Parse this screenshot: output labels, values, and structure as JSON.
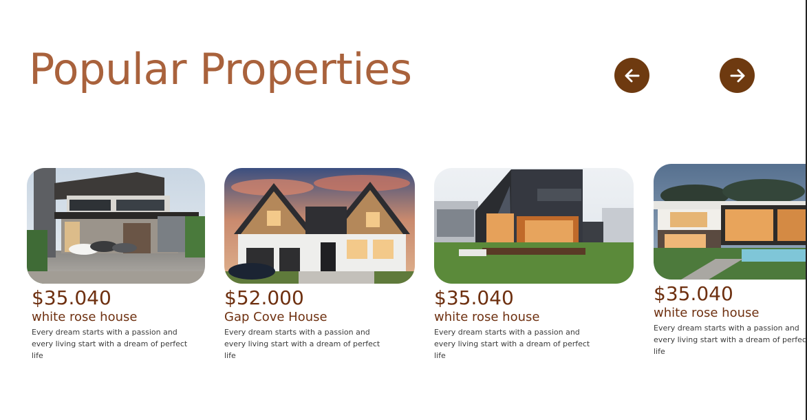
{
  "section": {
    "title": "Popular Properties"
  },
  "carousel": {
    "prev_icon": "arrow-left-icon",
    "next_icon": "arrow-right-icon",
    "button_color": "#6e3a10"
  },
  "colors": {
    "title": "#a9623c",
    "price": "#6e3010",
    "body_text": "#3a3a3a"
  },
  "properties": [
    {
      "price": "$35.040",
      "name": "white rose house",
      "description": "Every dream starts with a passion and every living start with a dream of perfect life",
      "image": "modern-two-story-villa-photo"
    },
    {
      "price": "$52.000",
      "name": "Gap Cove House",
      "description": "Every dream starts with a passion and every living start with a dream of perfect life",
      "image": "gabled-family-house-sunset-photo"
    },
    {
      "price": "$35.040",
      "name": "white rose house",
      "description": "Every dream starts with a passion and every living start with a dream of perfect life",
      "image": "dark-a-frame-house-photo"
    },
    {
      "price": "$35.040",
      "name": "white rose house",
      "description": "Every dream starts with a passion and every living start with a dream of perfect life",
      "image": "luxury-villa-pool-dusk-photo"
    }
  ]
}
